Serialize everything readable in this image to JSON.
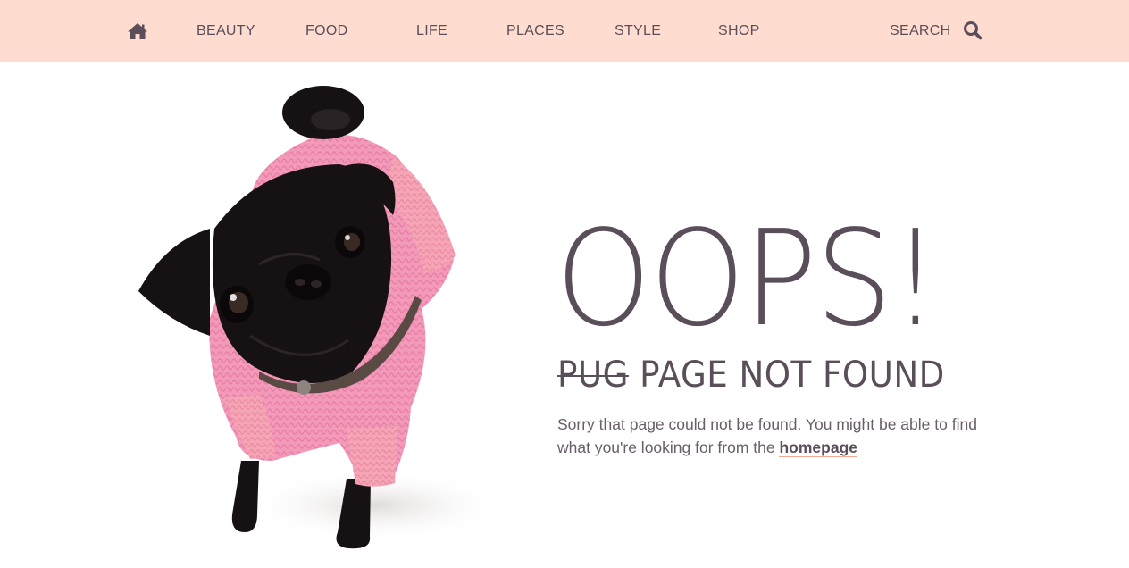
{
  "nav": {
    "home_icon": "home-icon",
    "items": [
      {
        "label": "BEAUTY"
      },
      {
        "label": "FOOD"
      },
      {
        "label": "LIFE"
      },
      {
        "label": "PLACES"
      },
      {
        "label": "STYLE"
      },
      {
        "label": "SHOP"
      }
    ],
    "search_label": "SEARCH",
    "search_icon": "magnifier-icon"
  },
  "error": {
    "heading": "OOPS!",
    "subtitle_struck": "PUG",
    "subtitle_rest": " PAGE NOT FOUND",
    "message_text": "Sorry that page could not be found. You might be able to find what you're looking for from the ",
    "homepage_link": "homepage"
  },
  "image": {
    "subject": "pug-in-pink-sweater"
  },
  "colors": {
    "nav_background": "#ffdcd0",
    "text": "#5a4e5a",
    "link_underline": "#f2a892",
    "sweater": "#f08fb0"
  }
}
